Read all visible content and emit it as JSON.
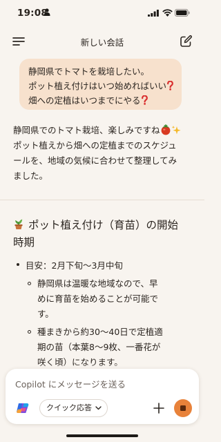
{
  "status_bar": {
    "time": "19:08"
  },
  "header": {
    "title": "新しい会話"
  },
  "user_message": {
    "lines": [
      "静岡県でトマトを栽培したい。",
      "ポット植え付けはいつ始めればいい",
      "畑への定植はいつまでにやる"
    ]
  },
  "reply": {
    "intro_lines": [
      "静岡県でのトマト栽培、楽しみですね",
      "ポット植えから畑への定植までのスケジュ",
      "ールを、地域の気候に合わせて整理してみ",
      "ました。"
    ],
    "section_heading_lines": [
      "ポット植え付け（育苗）の開始",
      "時期"
    ],
    "bullet_lines": [
      "目安：2月下旬〜3月中旬"
    ],
    "sub_bullets": [
      [
        "静岡県は温暖な地域なので、早",
        "めに育苗を始めることが可能で",
        "す。"
      ],
      [
        "種まきから約30〜40日で定植適",
        "期の苗（本葉8〜9枚、一番花が",
        "咲く頃）になります。"
      ]
    ]
  },
  "composer": {
    "placeholder": "Copilot にメッセージを送る",
    "mode_label": "クイック応答"
  },
  "colors": {
    "bubble": "#f7e1cd",
    "stop_button": "#e8823a",
    "question_mark": "#d92f2f",
    "background": "#f8f4ef"
  },
  "icons": [
    "person-icon",
    "signal-icon",
    "wifi-icon",
    "battery-icon",
    "menu-icon",
    "new-chat-icon",
    "question-mark-icon",
    "tomato-icon",
    "sparkles-icon",
    "potted-plant-icon",
    "copilot-logo-icon",
    "chevron-down-icon",
    "plus-icon",
    "stop-icon"
  ]
}
